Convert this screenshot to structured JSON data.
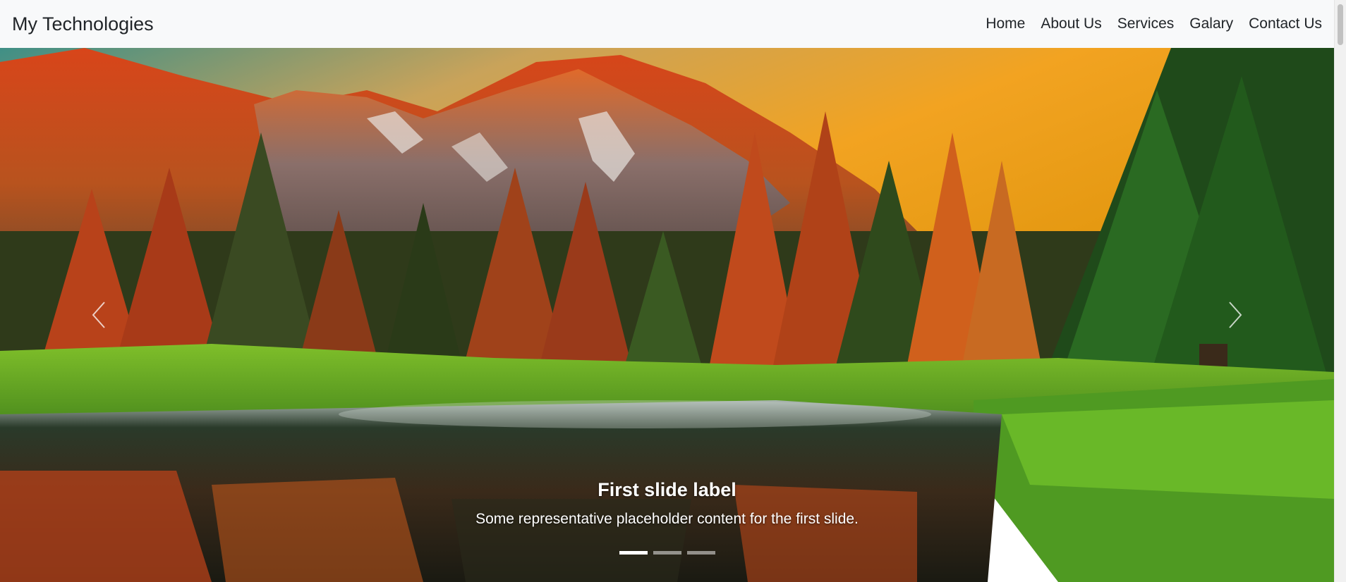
{
  "navbar": {
    "brand": "My Technologies",
    "links": [
      "Home",
      "About Us",
      "Services",
      "Galary",
      "Contact Us"
    ]
  },
  "carousel": {
    "slide_label": "First slide label",
    "slide_text": "Some representative placeholder content for the first slide.",
    "slide_count": 3,
    "active_index": 0,
    "prev_icon": "chevron-left-icon",
    "next_icon": "chevron-right-icon"
  }
}
